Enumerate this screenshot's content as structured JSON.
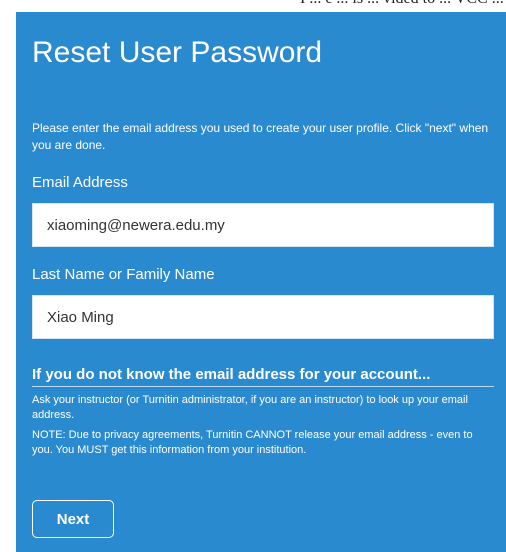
{
  "page": {
    "top_strip_text": "I ... e ... is ... vided to ... VCC ... ting y..."
  },
  "form": {
    "title": "Reset User Password",
    "intro": "Please enter the email address you used to create your user profile. Click \"next\" when you are done.",
    "email": {
      "label": "Email Address",
      "value": "xiaoming@newera.edu.my"
    },
    "last_name": {
      "label": "Last Name or Family Name",
      "value": "Xiao Ming"
    },
    "help_heading": "If you do not know the email address for your account...",
    "help_text": "Ask your instructor (or Turnitin administrator, if you are an instructor) to look up your email address.",
    "note_text": "NOTE: Due to privacy agreements, Turnitin CANNOT release your email address - even to you. You MUST get this information from your institution.",
    "next_label": "Next"
  },
  "colors": {
    "panel_background": "#2a8ad0",
    "text": "#ffffff"
  }
}
